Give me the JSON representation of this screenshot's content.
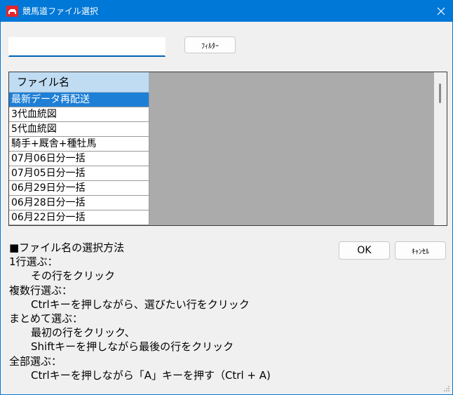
{
  "window": {
    "title": "競馬道ファイル選択",
    "accent_color": "#0078d7",
    "icon": "app-logo-icon",
    "close_icon": "close-icon"
  },
  "filter": {
    "input_value": "",
    "button_label": "ﾌｨﾙﾀｰ"
  },
  "file_list": {
    "column_header": "ファイル名",
    "selected_index": 0,
    "rows": [
      "最新データ再配送",
      "3代血統図",
      "5代血統図",
      "騎手+厩舎+種牡馬",
      "07月06日分一括",
      "07月05日分一括",
      "06月29日分一括",
      "06月28日分一括",
      "06月22日分一括"
    ]
  },
  "help": {
    "lines": [
      "■ファイル名の選択方法",
      "1行選ぶ：",
      "その行をクリック",
      "複数行選ぶ：",
      "Ctrlキーを押しながら、選びたい行をクリック",
      "まとめて選ぶ：",
      "最初の行をクリック、",
      "Shiftキーを押しながら最後の行をクリック",
      "全部選ぶ：",
      "Ctrlキーを押しながら「A」キーを押す（Ctrl + A)"
    ]
  },
  "actions": {
    "ok_label": "OK",
    "cancel_label": "ｷｬﾝｾﾙ"
  }
}
